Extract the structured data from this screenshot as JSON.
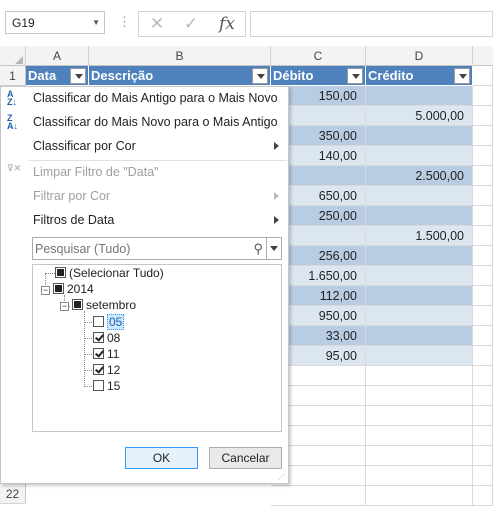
{
  "formula_bar": {
    "name_box": "G19",
    "cancel_icon": "close-icon",
    "enter_icon": "check-icon",
    "fx_label": "fx",
    "formula_value": ""
  },
  "columns": [
    "A",
    "B",
    "C",
    "D"
  ],
  "header_row": {
    "row_number": "1",
    "cells": [
      "Data",
      "Descrição",
      "Débito",
      "Crédito"
    ]
  },
  "data_rows": [
    {
      "debito": "150,00",
      "credito": ""
    },
    {
      "debito": "",
      "credito": "5.000,00"
    },
    {
      "debito": "350,00",
      "credito": ""
    },
    {
      "debito": "140,00",
      "credito": ""
    },
    {
      "debito": "",
      "credito": "2.500,00"
    },
    {
      "debito": "650,00",
      "credito": ""
    },
    {
      "debito": "250,00",
      "credito": ""
    },
    {
      "debito": "",
      "credito": "1.500,00"
    },
    {
      "debito": "256,00",
      "credito": ""
    },
    {
      "debito": "1.650,00",
      "credito": ""
    },
    {
      "debito": "112,00",
      "credito": ""
    },
    {
      "debito": "950,00",
      "credito": ""
    },
    {
      "debito": "33,00",
      "credito": ""
    },
    {
      "debito": "95,00",
      "credito": ""
    }
  ],
  "visible_row_numbers": [
    "22"
  ],
  "filter_menu": {
    "sort_old_new": "Classificar do Mais Antigo para o Mais Novo",
    "sort_new_old": "Classificar do Mais Novo para o Mais Antigo",
    "sort_by_color": "Classificar por Cor",
    "clear_filter": "Limpar Filtro de \"Data\"",
    "filter_by_color": "Filtrar por Cor",
    "date_filters": "Filtros de Data",
    "search_placeholder": "Pesquisar (Tudo)",
    "tree": {
      "select_all": "(Selecionar Tudo)",
      "year": "2014",
      "month": "setembro",
      "days": [
        {
          "label": "05",
          "checked": false
        },
        {
          "label": "08",
          "checked": true
        },
        {
          "label": "11",
          "checked": true
        },
        {
          "label": "12",
          "checked": true
        },
        {
          "label": "15",
          "checked": false
        }
      ]
    },
    "ok_label": "OK",
    "cancel_label": "Cancelar"
  }
}
